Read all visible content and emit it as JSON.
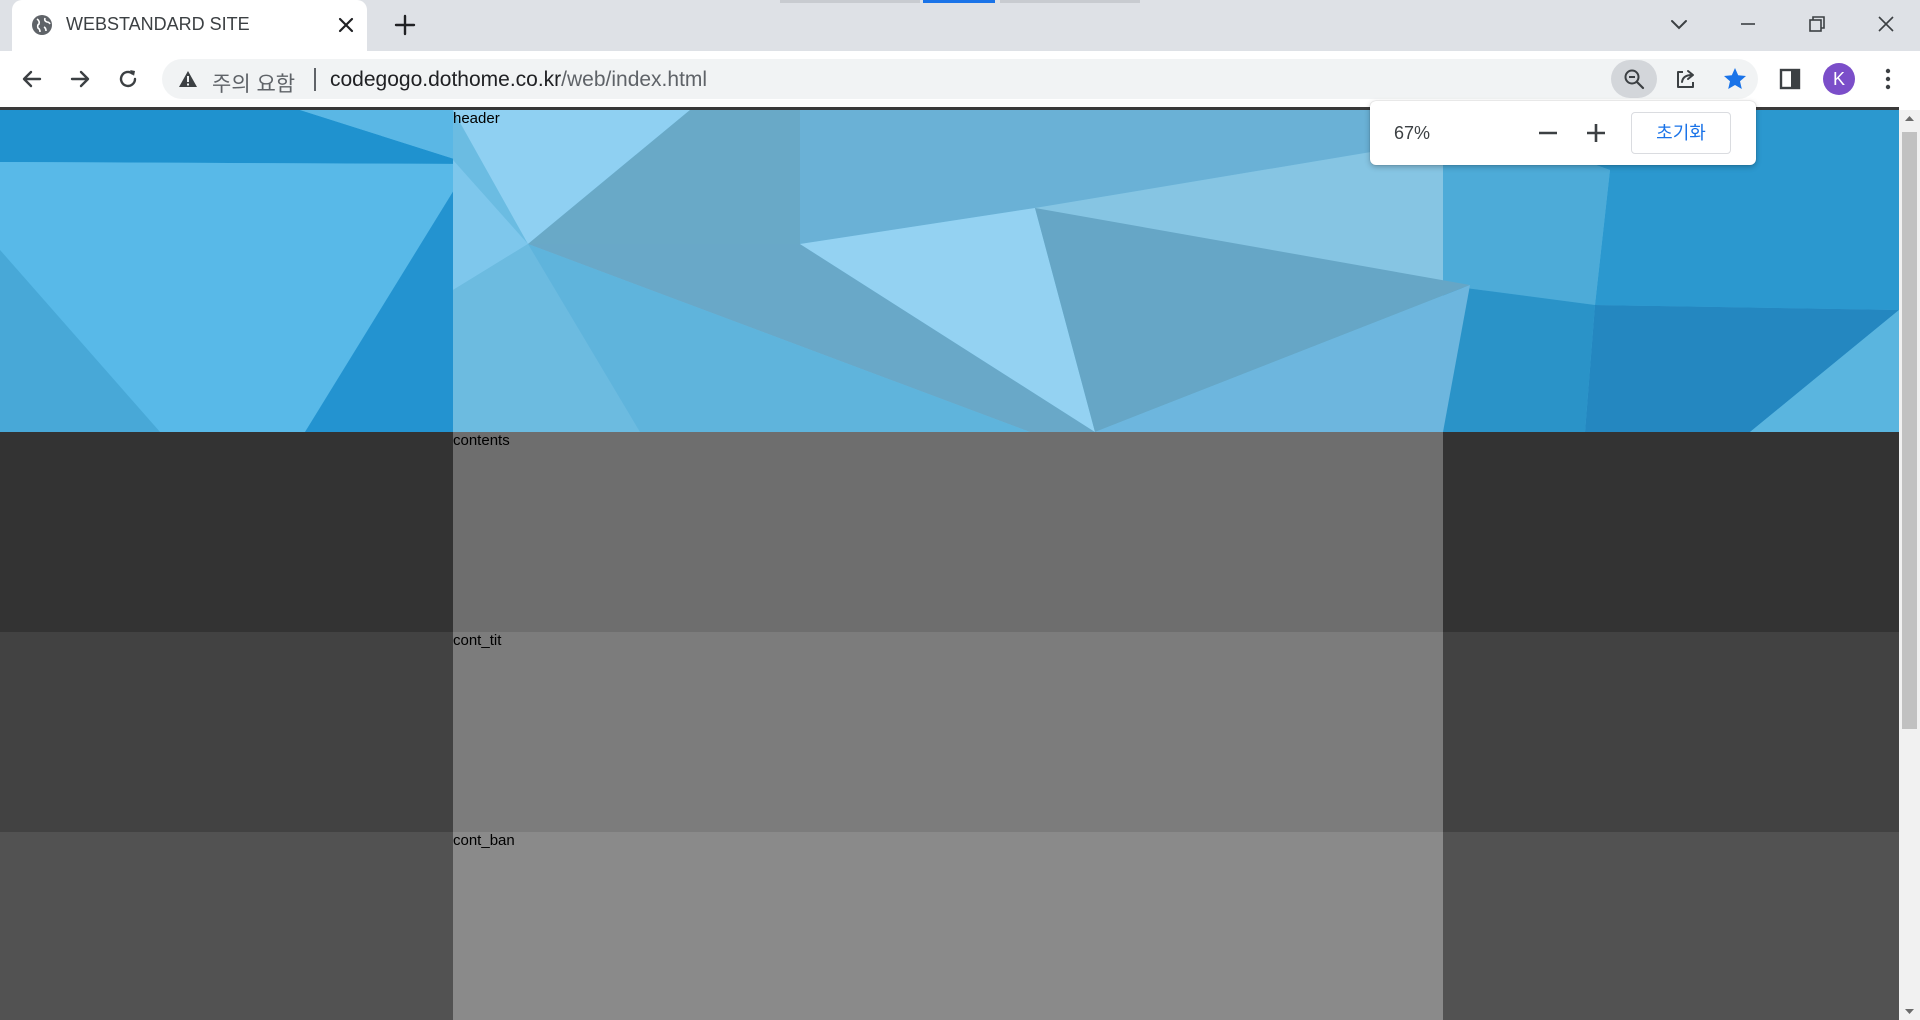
{
  "tab": {
    "title": "WEBSTANDARD SITE",
    "favicon": "globe-icon",
    "close_icon": "close-icon"
  },
  "toolbar": {
    "security_label": "주의 요함",
    "url_host": "codegogo.dothome.co.kr",
    "url_path": "/web/index.html"
  },
  "profile": {
    "avatar_letter": "K",
    "avatar_color": "#7b4ec9"
  },
  "zoom_popup": {
    "level": "67%",
    "reset_label": "초기화"
  },
  "page": {
    "sections": [
      {
        "label": "header"
      },
      {
        "label": "contents",
        "side_color": "#333333",
        "center_color": "#6e6e6e"
      },
      {
        "label": "cont_tit",
        "side_color": "#424242",
        "center_color": "#7c7c7c"
      },
      {
        "label": "cont_ban",
        "side_color": "#525252",
        "center_color": "#8a8a8a"
      }
    ]
  },
  "colors": {
    "accent": "#1a73e8",
    "tabstrip": "#dee1e6"
  }
}
